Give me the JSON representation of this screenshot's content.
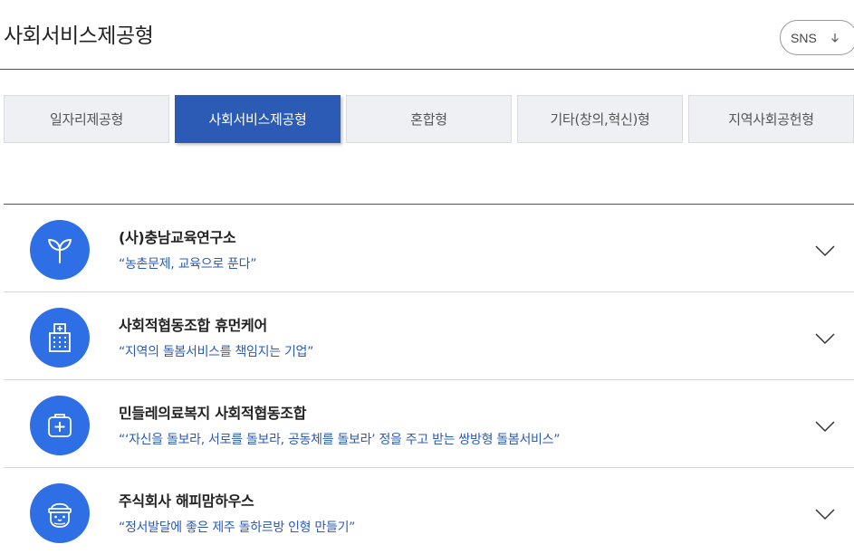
{
  "header": {
    "title": "사회서비스제공형",
    "sns_label": "SNS"
  },
  "tabs": [
    {
      "label": "일자리제공형",
      "active": false
    },
    {
      "label": "사회서비스제공형",
      "active": true
    },
    {
      "label": "혼합형",
      "active": false
    },
    {
      "label": "기타(창의,혁신)형",
      "active": false
    },
    {
      "label": "지역사회공헌형",
      "active": false
    }
  ],
  "colors": {
    "accent": "#2b5bb5",
    "icon_bg": "#2f6fe6"
  },
  "items": [
    {
      "name": "(사)충남교육연구소",
      "slogan": "“농촌문제, 교육으로 푼다”",
      "icon": "sprout-icon"
    },
    {
      "name": "사회적협동조합 휴먼케어",
      "slogan": "“지역의 돌봄서비스를 책임지는 기업”",
      "icon": "hospital-building-icon"
    },
    {
      "name": "민들레의료복지 사회적협동조합",
      "slogan": "“‘자신을 돌보라, 서로를 돌보라, 공동체를 돌보라’ 정을 주고 받는 쌍방형 돌봄서비스”",
      "icon": "medical-kit-icon"
    },
    {
      "name": "주식회사 해피맘하우스",
      "slogan": "“정서발달에 좋은 제주 돌하르방 인형 만들기”",
      "icon": "dolharubang-icon"
    }
  ]
}
